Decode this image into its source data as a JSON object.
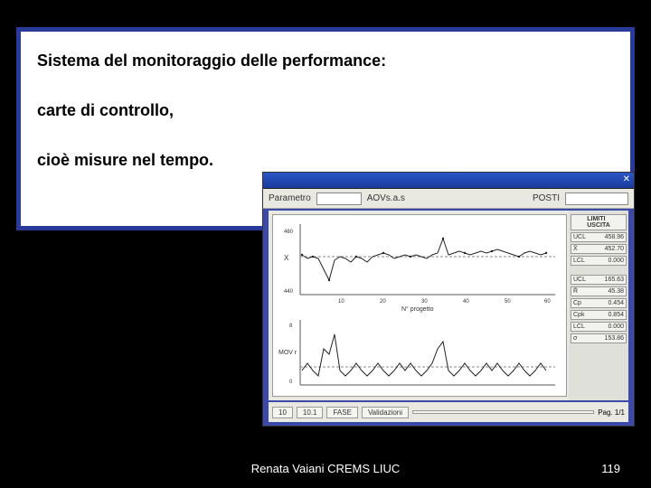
{
  "panel": {
    "line1": "Sistema del monitoraggio delle performance:",
    "line2": "carte di controllo,",
    "line3": "cioè misure nel tempo."
  },
  "footer": {
    "author": "Renata Vaiani CREMS LIUC",
    "page": "119"
  },
  "chart_window": {
    "param_label": "AOVs.a.s",
    "param_right": "POSTI"
  },
  "chart_data": [
    {
      "type": "line",
      "title": "",
      "ylabel": "X",
      "xlabel": "N° progetto",
      "x_ticks": [
        10,
        20,
        30,
        40,
        50,
        60
      ],
      "x": [
        1,
        2,
        3,
        4,
        5,
        6,
        7,
        8,
        9,
        10,
        11,
        12,
        13,
        14,
        15,
        16,
        17,
        18,
        19,
        20,
        21,
        22,
        23,
        24,
        25,
        26,
        27,
        28,
        29,
        30,
        31,
        32,
        33,
        34,
        35,
        36,
        37,
        38,
        39,
        40,
        41,
        42,
        43,
        44,
        45,
        46
      ],
      "values": [
        456,
        454,
        455,
        454,
        450,
        445,
        452,
        453,
        452,
        451,
        453,
        452,
        451,
        453,
        454,
        455,
        454,
        452,
        453,
        454,
        453,
        454,
        453,
        452,
        454,
        455,
        460,
        454,
        455,
        456,
        455,
        454,
        455,
        456,
        455,
        456,
        457,
        456,
        455,
        454,
        453,
        455,
        456,
        455,
        454,
        455
      ],
      "reference_lines": {
        "UCL": 458.96,
        "mean": 452.7,
        "LCL": 0.0
      },
      "ylim": [
        440,
        465
      ]
    },
    {
      "type": "line",
      "title": "",
      "ylabel": "MOV r",
      "xlabel": "",
      "x": [
        1,
        2,
        3,
        4,
        5,
        6,
        7,
        8,
        9,
        10,
        11,
        12,
        13,
        14,
        15,
        16,
        17,
        18,
        19,
        20,
        21,
        22,
        23,
        24,
        25,
        26,
        27,
        28,
        29,
        30,
        31,
        32,
        33,
        34,
        35,
        36,
        37,
        38,
        39,
        40,
        41,
        42,
        43,
        44,
        45,
        46
      ],
      "values": [
        2,
        3,
        2,
        1,
        5,
        4,
        7,
        2,
        1,
        2,
        3,
        2,
        1,
        2,
        3,
        2,
        1,
        2,
        3,
        2,
        3,
        2,
        1,
        2,
        3,
        5,
        6,
        2,
        1,
        2,
        3,
        2,
        1,
        2,
        3,
        2,
        3,
        2,
        1,
        2,
        3,
        2,
        1,
        2,
        3,
        2
      ],
      "reference_lines": {
        "UCL": 165.63,
        "mean": 45.38,
        "LCL": 0.0
      },
      "ylim": [
        0,
        10
      ]
    }
  ],
  "stats": {
    "top": [
      {
        "k": "UCL",
        "v": "458.96"
      },
      {
        "k": "X̄",
        "v": "452.70"
      },
      {
        "k": "LCL",
        "v": "0.000"
      }
    ],
    "bottom": [
      {
        "k": "UCL",
        "v": "165.63"
      },
      {
        "k": "R̄",
        "v": "45.38"
      },
      {
        "k": "Cp",
        "v": "0.454"
      },
      {
        "k": "Cpk",
        "v": "0.854"
      },
      {
        "k": "LCL",
        "v": "0.000"
      },
      {
        "k": "σ",
        "v": "153.86"
      }
    ]
  },
  "bottom_buttons": [
    "10",
    "10.1",
    "FASE",
    "Validazioni"
  ],
  "bottom_long": "",
  "bottom_right": "Pag. 1/1"
}
